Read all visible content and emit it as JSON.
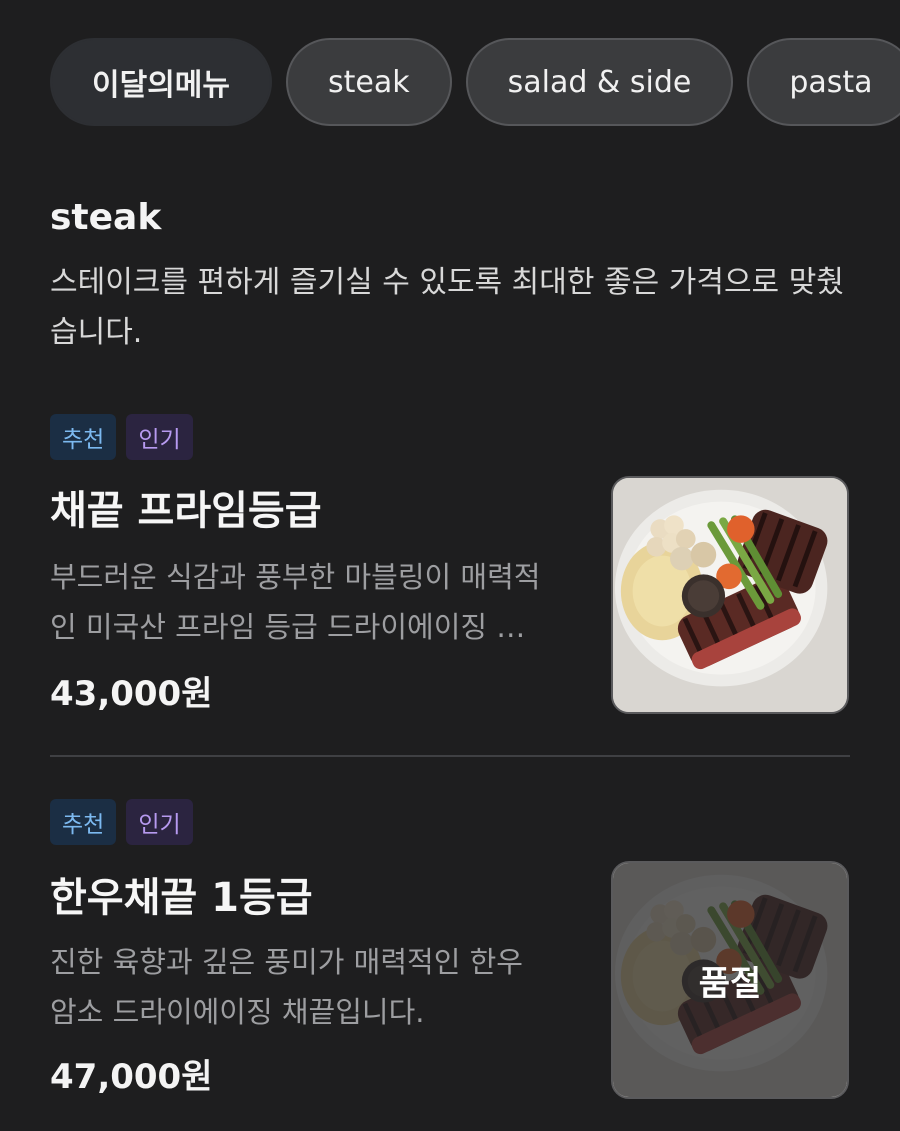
{
  "tabs": [
    {
      "label": "이달의메뉴",
      "active": true
    },
    {
      "label": "steak",
      "active": false
    },
    {
      "label": "salad & side",
      "active": false
    },
    {
      "label": "pasta",
      "active": false
    }
  ],
  "section": {
    "title": "steak",
    "description": "스테이크를 편하게 즐기실 수 있도록 최대한 좋은 가격으로 맞췄습니다."
  },
  "items": [
    {
      "badges": [
        "추천",
        "인기"
      ],
      "name": "채끝 프라임등급",
      "description": "부드러운 식감과 풍부한 마블링이 매력적인 미국산 프라임 등급 드라이에이징 채끝입니다.",
      "price": "43,000원",
      "image": "steak-plate-photo",
      "sold_out": false
    },
    {
      "badges": [
        "추천",
        "인기"
      ],
      "name": "한우채끝 1등급",
      "description": "진한 육향과 깊은 풍미가 매력적인 한우 암소 드라이에이징 채끝입니다.",
      "price": "47,000원",
      "image": "steak-plate-photo",
      "sold_out": true,
      "sold_out_label": "품절"
    }
  ],
  "colors": {
    "background": "#1e1e1f",
    "tab_bg": "#3b3c3e",
    "tab_active_bg": "#2d2f33",
    "badge_recommend_text": "#7cb9f0",
    "badge_popular_text": "#b79af0",
    "muted_text": "#9d9ea1"
  }
}
